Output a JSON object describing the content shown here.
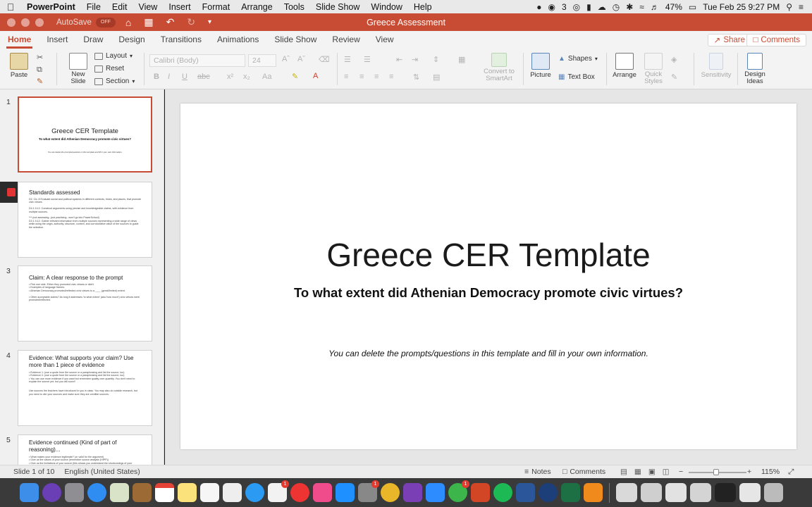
{
  "menubar": {
    "apple": "",
    "items": [
      "PowerPoint",
      "File",
      "Edit",
      "View",
      "Insert",
      "Format",
      "Arrange",
      "Tools",
      "Slide Show",
      "Window",
      "Help"
    ],
    "status": {
      "notification_count": "3",
      "battery": "47%",
      "datetime": "Tue Feb 25  9:27 PM"
    }
  },
  "titlebar": {
    "autosave_label": "AutoSave",
    "autosave_state": "OFF",
    "document_title": "Greece Assessment"
  },
  "ribbon_tabs": {
    "tabs": [
      "Home",
      "Insert",
      "Draw",
      "Design",
      "Transitions",
      "Animations",
      "Slide Show",
      "Review",
      "View"
    ],
    "active": "Home",
    "share_label": "Share",
    "comments_label": "Comments"
  },
  "ribbon": {
    "paste": "Paste",
    "new_slide": "New\nSlide",
    "layout": "Layout",
    "reset": "Reset",
    "section": "Section",
    "font_name_placeholder": "Calibri (Body)",
    "font_size_placeholder": "24",
    "convert_smartart": "Convert to\nSmartArt",
    "picture": "Picture",
    "shapes": "Shapes",
    "text_box": "Text Box",
    "arrange": "Arrange",
    "quick_styles": "Quick\nStyles",
    "sensitivity": "Sensitivity",
    "design_ideas": "Design\nIdeas"
  },
  "thumbnails": [
    {
      "number": "1",
      "title": "Greece CER Template",
      "subtitle": "To what extent did Athenian Democracy promote civic virtues?",
      "note": "You can delete the prompts/questions in this template and fill in your own information."
    },
    {
      "number": "",
      "title": "Standards assessed",
      "body": "D2. Civ. 8 Evaluate social and political systems in different contexts, times, and places, that promote civic virtues.\n\nD4.1.9-12. Construct arguments using precise and knowledgeable claims, with evidence from multiple sources.\n\n*** (not assessing...just practicing...won't go into PowerSchool)\nD3.1.9-12. Gather relevant information from multiple sources representing a wide range of views while using the origin, authority, structure, context, and corroborative value of the sources to guide the selection."
    },
    {
      "number": "3",
      "title": "Claim: A clear response to the prompt",
      "body": "• Pick one side. Either they promoted civic virtues or didn't\n• Examples of language frames:\n   • Athenian Democracy promoted/reflected civic virtues to a ____ (great/limited) extent.\n\n   • Other acceptable claims? As long it addresses 'to what extent' (aka 'how much') civic virtues were promoted/reflected."
    },
    {
      "number": "4",
      "title": "Evidence: What supports your claim? Use more than 1 piece of evidence",
      "body": "• Evidence 1: (use a quote from the source or a paraphrasing and list the source, too)\n• Evidence 2: (use a quote from the source or a paraphrasing and list the source, too)\n• You can use more evidence if you want but remember quality over quantity. You don't need to explain the source yet- but you will soon!!\n\n\nUse sources the teachers have introduced to you in class. You may also do outside research, but you need to cite your sources and make sure they are credible sources."
    },
    {
      "number": "5",
      "title": "Evidence continued (Kind of part of reasoning)...",
      "body": "• What makes your evidence legitimate? (or valid for the argument)\n   • Give us the values of your source (remember source analysis (HIPP))\n   • Give us the limitations of your source (this shows you understand the shortcomings of your"
    }
  ],
  "slide": {
    "title": "Greece CER Template",
    "subtitle": "To what extent did Athenian Democracy promote civic virtues?",
    "note": "You can delete the prompts/questions in this template and fill in your own information."
  },
  "statusbar": {
    "slide_count": "Slide 1 of 10",
    "language": "English (United States)",
    "notes": "Notes",
    "comments": "Comments",
    "zoom": "115%"
  },
  "dock": {
    "badges": [
      "1",
      "1",
      "1"
    ]
  }
}
